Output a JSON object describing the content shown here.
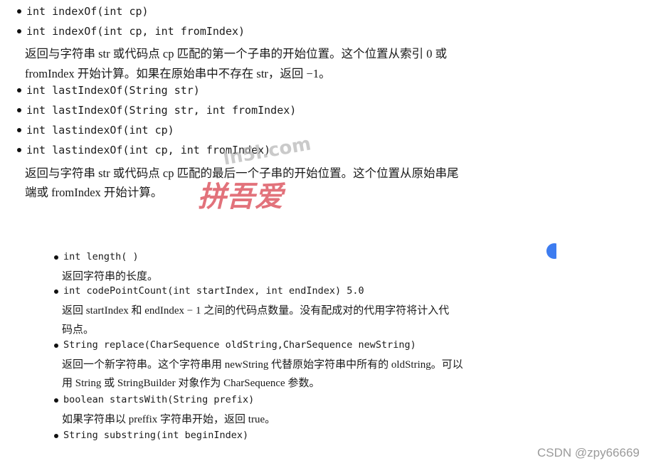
{
  "top": {
    "items": [
      {
        "type": "code",
        "text": "int indexOf(int cp)"
      },
      {
        "type": "code",
        "text": "int indexOf(int cp, int fromIndex)"
      },
      {
        "type": "text",
        "text": "返回与字符串 str 或代码点 cp 匹配的第一个子串的开始位置。这个位置从索引 0 或"
      },
      {
        "type": "text",
        "text": "fromIndex 开始计算。如果在原始串中不存在 str，返回 −1。"
      },
      {
        "type": "code",
        "text": "int lastIndexOf(String str)"
      },
      {
        "type": "code",
        "text": "int lastIndexOf(String str, int fromIndex)"
      },
      {
        "type": "code",
        "text": "int lastindexOf(int cp)"
      },
      {
        "type": "code",
        "text": "int lastindexOf(int cp, int fromIndex)"
      },
      {
        "type": "text",
        "text": "返回与字符串 str 或代码点 cp 匹配的最后一个子串的开始位置。这个位置从原始串尾"
      },
      {
        "type": "text",
        "text": "端或 fromIndex 开始计算。"
      }
    ]
  },
  "bottom": {
    "items": [
      {
        "type": "code",
        "text": "int length( )"
      },
      {
        "type": "text",
        "text": "返回字符串的长度。"
      },
      {
        "type": "code",
        "text": "int codePointCount(int startIndex, int endIndex) 5.0"
      },
      {
        "type": "text",
        "text": "返回 startIndex 和 endIndex − 1 之间的代码点数量。没有配成对的代用字符将计入代"
      },
      {
        "type": "text",
        "text": "码点。"
      },
      {
        "type": "code",
        "text": "String replace(CharSequence oldString,CharSequence newString)"
      },
      {
        "type": "text",
        "text": "返回一个新字符串。这个字符串用 newString 代替原始字符串中所有的 oldString。可以"
      },
      {
        "type": "text",
        "text": "用 String 或 StringBuilder 对象作为 CharSequence 参数。"
      },
      {
        "type": "code",
        "text": "boolean startsWith(String prefix)"
      },
      {
        "type": "text",
        "text": "如果字符串以 preffix 字符串开始，返回 true。"
      },
      {
        "type": "code",
        "text": "String substring(int beginIndex)"
      }
    ]
  },
  "watermark": {
    "site": "ln5l.com",
    "logo": "拼吾爱",
    "color": "#d9434f"
  },
  "credit": "CSDN @zpy66669",
  "colors": {
    "accent_blue": "#3d7cf0"
  }
}
